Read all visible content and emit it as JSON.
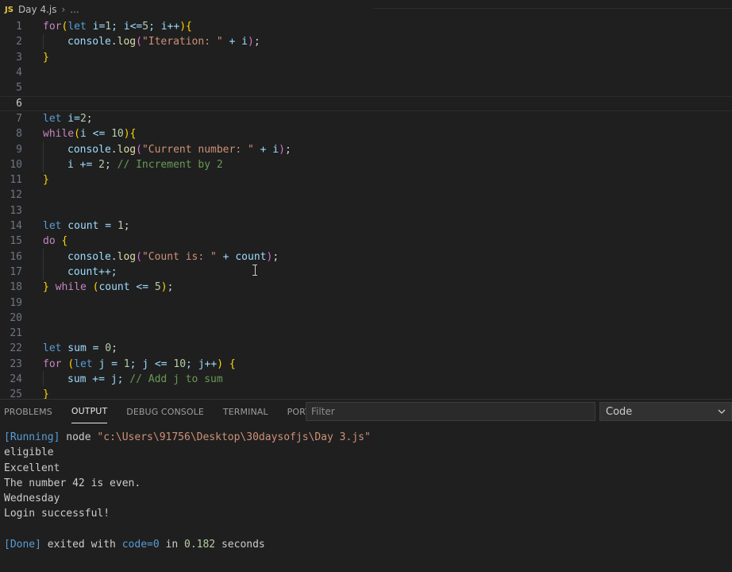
{
  "breadcrumb": {
    "lang_badge": "JS",
    "file": "Day 4.js",
    "more": "..."
  },
  "editor": {
    "lines": [
      {
        "n": "1"
      },
      {
        "n": "2"
      },
      {
        "n": "3"
      },
      {
        "n": "4"
      },
      {
        "n": "5"
      },
      {
        "n": "6"
      },
      {
        "n": "7"
      },
      {
        "n": "8"
      },
      {
        "n": "9"
      },
      {
        "n": "10"
      },
      {
        "n": "11"
      },
      {
        "n": "12"
      },
      {
        "n": "13"
      },
      {
        "n": "14"
      },
      {
        "n": "15"
      },
      {
        "n": "16"
      },
      {
        "n": "17"
      },
      {
        "n": "18"
      },
      {
        "n": "19"
      },
      {
        "n": "20"
      },
      {
        "n": "21"
      },
      {
        "n": "22"
      },
      {
        "n": "23"
      },
      {
        "n": "24"
      },
      {
        "n": "25"
      }
    ],
    "current_line": "6",
    "tokens": {
      "l1": [
        "for",
        "(",
        "let",
        " i=",
        "1",
        "; i<=",
        "5",
        "; i++",
        ")",
        "{"
      ],
      "l2": [
        "console",
        ".",
        "log",
        "(",
        "\"Iteration: \"",
        " + i",
        ")",
        ";"
      ],
      "l3": [
        "}"
      ],
      "l7": [
        "let",
        " i=",
        "2",
        ";"
      ],
      "l8": [
        "while",
        "(",
        "i <= ",
        "10",
        ")",
        "{"
      ],
      "l9": [
        "console",
        ".",
        "log",
        "(",
        "\"Current number: \"",
        " + i",
        ")",
        ";"
      ],
      "l10": [
        "i += ",
        "2",
        "; ",
        "// Increment by 2"
      ],
      "l11": [
        "}"
      ],
      "l14": [
        "let",
        " count = ",
        "1",
        ";"
      ],
      "l15": [
        "do",
        " ",
        "{"
      ],
      "l16": [
        "console",
        ".",
        "log",
        "(",
        "\"Count is: \"",
        " + count",
        ")",
        ";"
      ],
      "l17": [
        "count++;"
      ],
      "l18": [
        "}",
        " ",
        "while",
        " ",
        "(",
        "count <= ",
        "5",
        ")",
        ";"
      ],
      "l22": [
        "let",
        " sum = ",
        "0",
        ";"
      ],
      "l23": [
        "for",
        " ",
        "(",
        "let",
        " j = ",
        "1",
        "; j <= ",
        "10",
        "; j++",
        ")",
        " ",
        "{"
      ],
      "l24": [
        "sum += j; ",
        "// Add j to sum"
      ],
      "l25": [
        "}"
      ]
    }
  },
  "panel": {
    "tabs": [
      {
        "label": "PROBLEMS"
      },
      {
        "label": "OUTPUT"
      },
      {
        "label": "DEBUG CONSOLE"
      },
      {
        "label": "TERMINAL"
      },
      {
        "label": "PORTS"
      }
    ],
    "active_tab": "OUTPUT",
    "filter_placeholder": "Filter",
    "channel_selected": "Code",
    "output": {
      "running_tag": "[Running]",
      "running_cmd": " node ",
      "running_path": "\"c:\\Users\\91756\\Desktop\\30daysofjs\\Day 3.js\"",
      "lines": [
        "eligible",
        "Excellent",
        "The number 42 is even.",
        "Wednesday",
        "Login successful!"
      ],
      "done_tag": "[Done]",
      "done_text1": " exited with ",
      "done_code": "code=0",
      "done_text2": " in ",
      "done_time": "0.182",
      "done_text3": " seconds"
    }
  },
  "colors": {
    "background": "#1f1f1f",
    "keyword": "#569cd6",
    "control": "#c586c0",
    "function": "#dcdcaa",
    "variable": "#9cdcfe",
    "string": "#ce9178",
    "number": "#b5cea8",
    "comment": "#6a9955"
  }
}
